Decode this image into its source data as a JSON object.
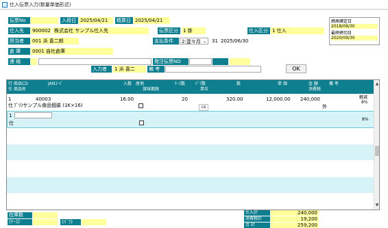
{
  "window": {
    "title": "仕入伝票入力(数量単価形式)"
  },
  "header": {
    "denpyo_no_label": "伝票No",
    "denpyo_no_value": "",
    "nyuka_date_label": "入荷日",
    "nyuka_date_value": "2025/04/21",
    "keijo_date_label": "精算日",
    "keijo_date_value": "2025/04/21",
    "shiiresaki_label": "仕入先",
    "shiiresaki_code": "900002",
    "shiiresaki_name": "株式会社 サンプル仕入先",
    "denpyo_kubun_label": "伝票区分",
    "denpyo_kubun_value": "1 掛",
    "shiire_kubun_label": "仕入区分",
    "shiire_kubun_value": "1 仕入",
    "tantosha_label": "担当者",
    "tantosha_value": "001 浜 喜二郎",
    "shiharai_label": "支払条件",
    "shiharai_select": "2:翌々月",
    "shiharai_day": "31",
    "shiharai_date": "2025/06/30",
    "soko_label": "倉 庫",
    "soko_value": "0001 自社倉庫",
    "renraku_label": "連 絡",
    "renraku_value": "",
    "hatchu_label": "発注伝票NO",
    "nyuryokusha_label": "入力者",
    "nyuryokusha_value": "1 浜 喜二",
    "biko_label": "備 考",
    "biko_value": "",
    "ok_label": "OK"
  },
  "right_panel": {
    "label1": "締高確定日",
    "value1": "2018/09/30",
    "label2": "最終締切日",
    "value2": "2020/09/30"
  },
  "grid": {
    "header_line1": [
      "行",
      "商品CD",
      "JANｺｰﾄﾞ",
      "入数",
      "産地",
      "ｹｰｽ数",
      "ﾊﾞﾗ数",
      "数",
      "単 価",
      "金 額",
      "備 考"
    ],
    "header_line2": [
      "仕",
      "商品名",
      "賞味期限",
      "単位",
      "消費税"
    ],
    "rows": [
      {
        "line": "1",
        "code": "40003",
        "irisu": "16.00",
        "cases": "20",
        "bara": "",
        "qty": "320.00",
        "price": "12,000.00",
        "amount": "240,000",
        "note": "軽減",
        "tax_rate": "8%",
        "kubun": "仕",
        "name": "ﾌﾟﾘ)サンプル食品個装 (1K×16)",
        "unit": "cs",
        "tax": "外"
      },
      {
        "line": "1",
        "kubun": "仕",
        "tax_rate": "8%"
      }
    ]
  },
  "footer": {
    "zaiko_label": "在庫数",
    "case_label": "(ｹｰｽ)",
    "bara_label": "(ﾊﾞﾗ)",
    "zaiko_case": "",
    "zaiko_bara": "",
    "shiire_kei_label": "仕入計",
    "shiire_kei_value": "240,000",
    "shohizei_label": "消費税計",
    "shohizei_value": "19,200",
    "gokei_label": "合 計",
    "gokei_value": "259,200"
  },
  "colors": {
    "teal": "#0d7f8f",
    "yellow": "#ffff9c",
    "cyan": "#d6f4f8"
  }
}
